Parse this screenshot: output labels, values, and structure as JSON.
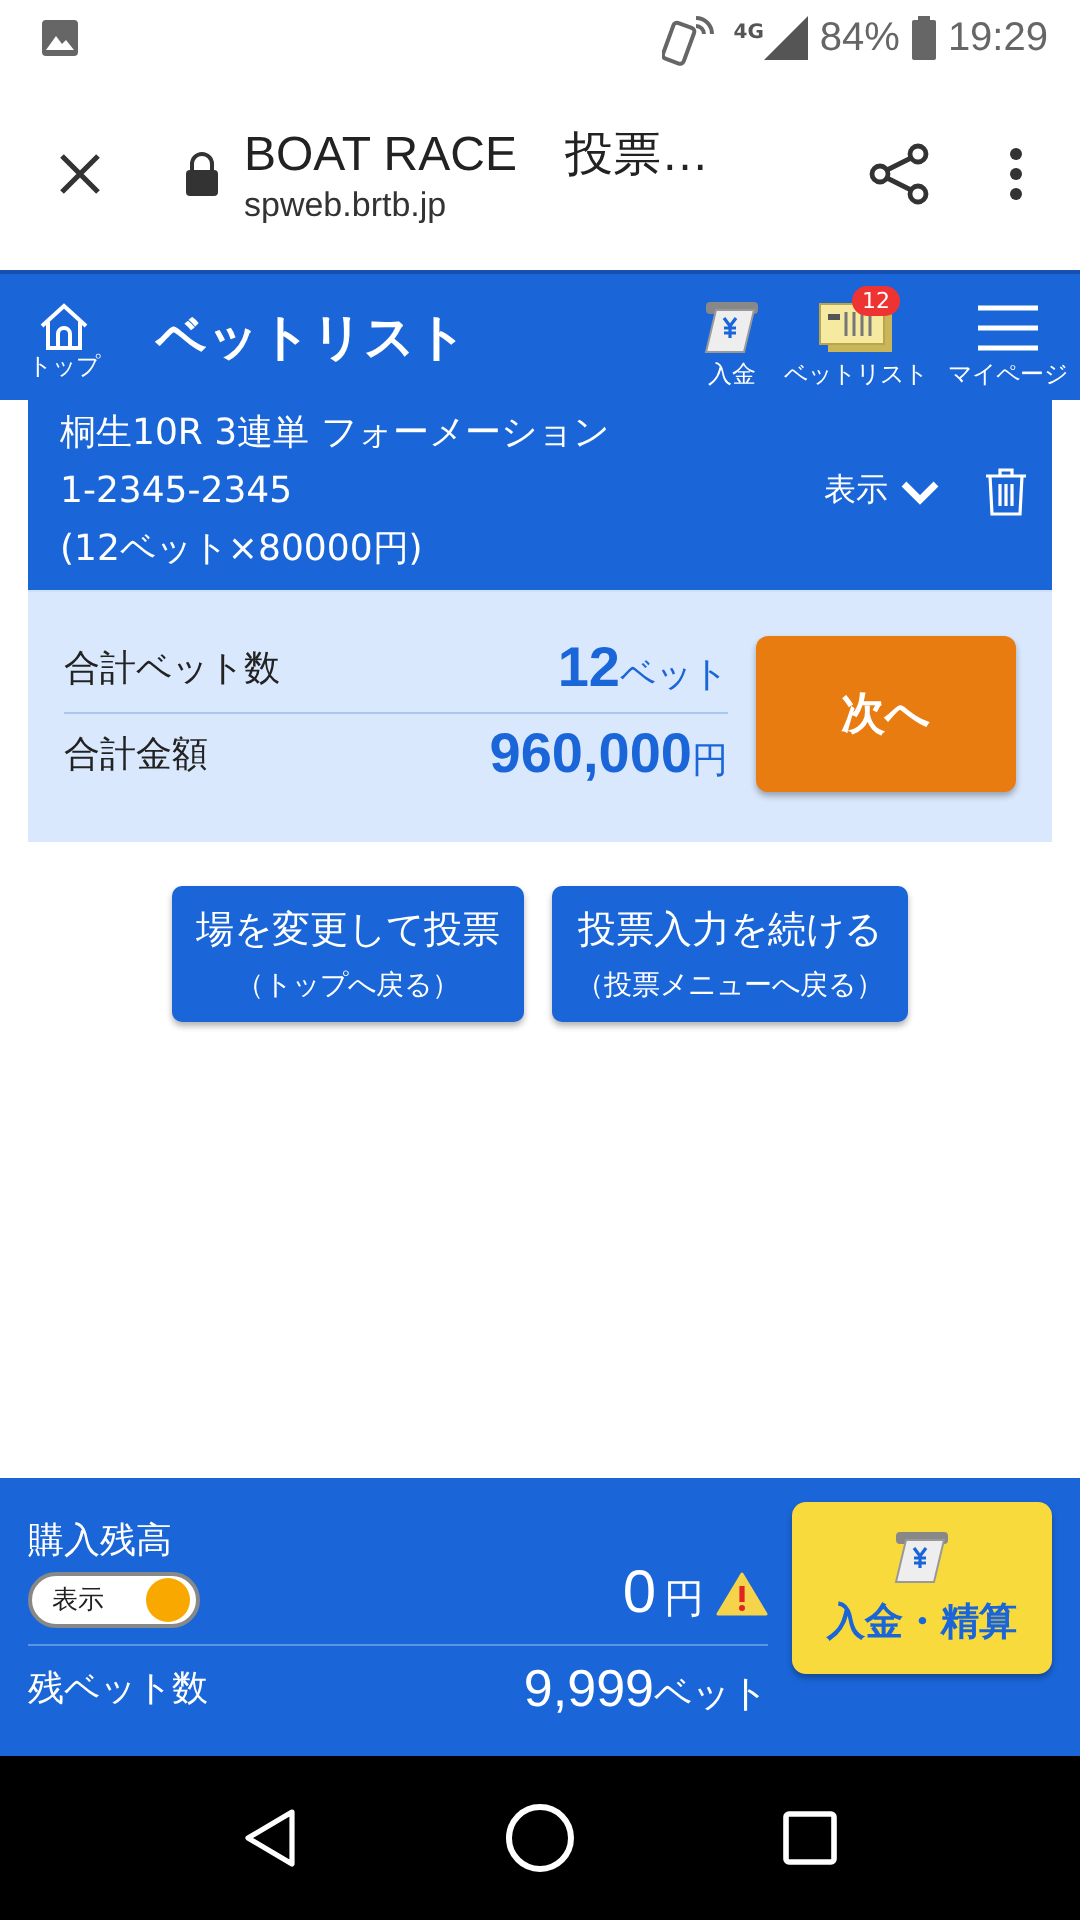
{
  "status_bar": {
    "battery": "84%",
    "time": "19:29",
    "network": "4G"
  },
  "browser": {
    "title": "BOAT RACE　投票…",
    "url": "spweb.brtb.jp"
  },
  "header": {
    "home_label": "トップ",
    "title": "ベットリスト",
    "actions": [
      {
        "kind": "deposit",
        "label": "入金"
      },
      {
        "kind": "betlist",
        "label": "ベットリスト",
        "badge": "12"
      },
      {
        "kind": "menu",
        "label": "マイページ"
      }
    ]
  },
  "bet": {
    "lines": [
      "桐生10R 3連単 フォーメーション",
      "1-2345-2345",
      "(12ベット×80000円)"
    ],
    "toggle_label": "表示",
    "expanded": false
  },
  "summary": {
    "rows": [
      {
        "label": "合計ベット数",
        "value": "12",
        "unit": "ベット"
      },
      {
        "label": "合計金額",
        "value": "960,000",
        "unit": "円"
      }
    ],
    "next": "次へ"
  },
  "buttons": [
    {
      "main": "場を変更して投票",
      "sub": "（トップへ戻る）"
    },
    {
      "main": "投票入力を続ける",
      "sub": "（投票メニューへ戻る）"
    }
  ],
  "footer": {
    "balance_label": "購入残高",
    "show_toggle": {
      "label": "表示",
      "on": true
    },
    "balance": "0",
    "balance_unit": "円",
    "warning": true,
    "remaining_label": "残ベット数",
    "remaining": "9,999",
    "remaining_unit": "ベット",
    "deposit_button": "入金・精算"
  }
}
